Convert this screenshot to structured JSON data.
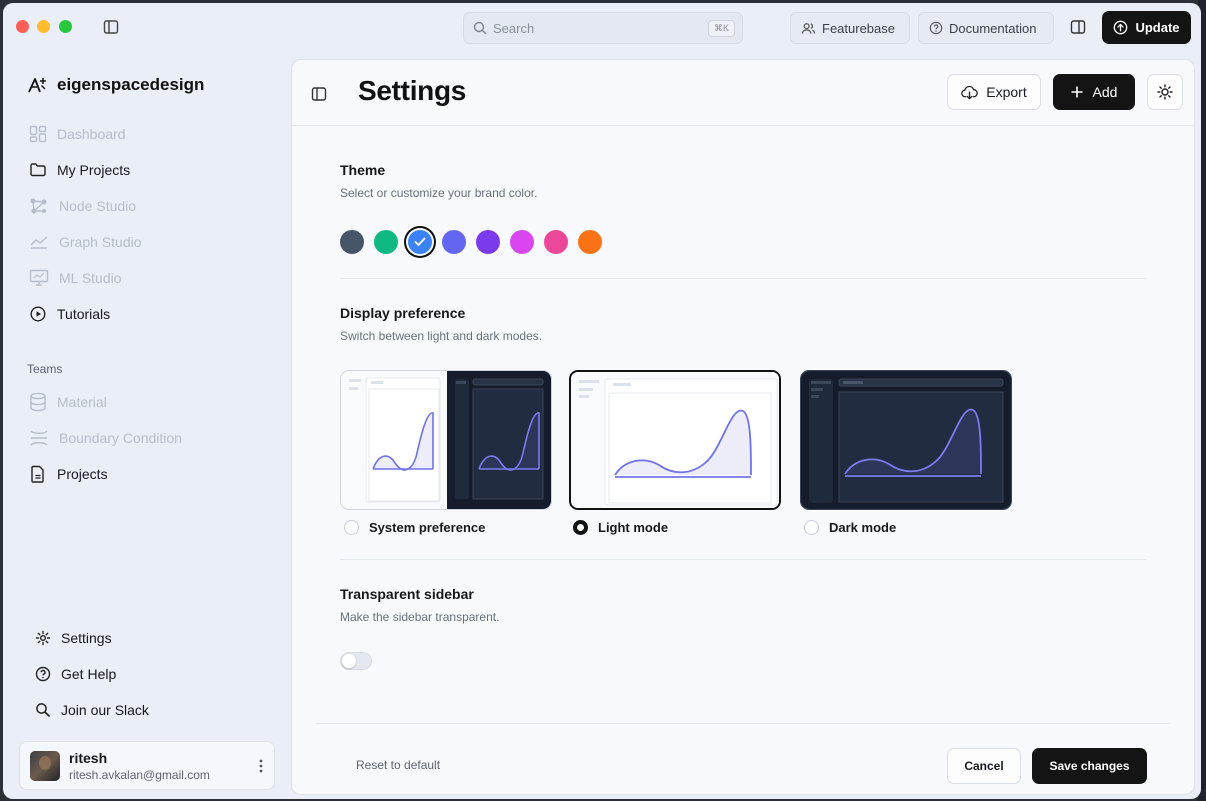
{
  "titlebar": {
    "search_placeholder": "Search",
    "search_shortcut": "⌘K",
    "featurebase_label": "Featurebase",
    "documentation_label": "Documentation",
    "update_label": "Update"
  },
  "sidebar": {
    "brand": "eigenspacedesign",
    "items": [
      {
        "label": "Dashboard",
        "icon": "dashboard-icon",
        "enabled": false
      },
      {
        "label": "My Projects",
        "icon": "folder-icon",
        "enabled": true
      },
      {
        "label": "Node Studio",
        "icon": "nodes-icon",
        "enabled": false
      },
      {
        "label": "Graph Studio",
        "icon": "chart-line-icon",
        "enabled": false
      },
      {
        "label": "ML Studio",
        "icon": "monitor-icon",
        "enabled": false
      },
      {
        "label": "Tutorials",
        "icon": "play-circle-icon",
        "enabled": true
      }
    ],
    "teams_label": "Teams",
    "team_items": [
      {
        "label": "Material",
        "icon": "database-icon",
        "enabled": false
      },
      {
        "label": "Boundary Condition",
        "icon": "boundary-icon",
        "enabled": false
      },
      {
        "label": "Projects",
        "icon": "file-icon",
        "enabled": true
      }
    ],
    "bottom_items": [
      {
        "label": "Settings",
        "icon": "gear-icon"
      },
      {
        "label": "Get Help",
        "icon": "help-circle-icon"
      },
      {
        "label": "Join our Slack",
        "icon": "search-icon"
      }
    ],
    "user": {
      "name": "ritesh",
      "email": "ritesh.avkalan@gmail.com"
    }
  },
  "main": {
    "title": "Settings",
    "export_label": "Export",
    "add_label": "Add",
    "theme": {
      "title": "Theme",
      "description": "Select or customize your brand color.",
      "swatches": [
        "#475569",
        "#10b981",
        "#3b82f6",
        "#6366f1",
        "#7c3aed",
        "#d946ef",
        "#ec4899",
        "#f97316"
      ],
      "selected": "#3b82f6"
    },
    "display": {
      "title": "Display preference",
      "description": "Switch between light and dark modes.",
      "options": [
        {
          "label": "System preference",
          "checked": false
        },
        {
          "label": "Light mode",
          "checked": true
        },
        {
          "label": "Dark mode",
          "checked": false
        }
      ]
    },
    "sidebar_pref": {
      "title": "Transparent sidebar",
      "description": "Make the sidebar transparent.",
      "enabled": false
    },
    "footer": {
      "reset_label": "Reset to default",
      "cancel_label": "Cancel",
      "save_label": "Save changes"
    }
  }
}
